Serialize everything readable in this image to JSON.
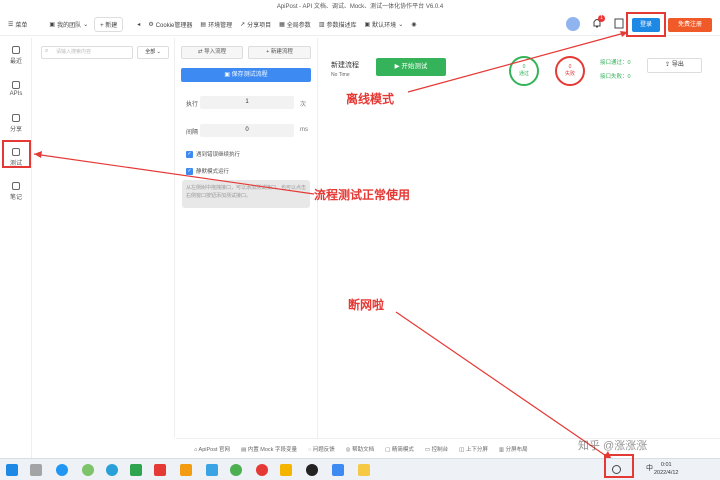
{
  "window": {
    "title": "ApiPost - API 文档、调试、Mock、测试一体化协作平台 V6.0.4"
  },
  "topbar": {
    "menu": "菜单",
    "team": "我的团队",
    "new": "+ 新建",
    "cookie": "Cookie管理器",
    "env": "环境管理",
    "share": "分享项目",
    "global": "全局参数",
    "params": "参数描述库",
    "env_select": "默认环境",
    "login": "登录",
    "register": "免费注册",
    "badge": "1"
  },
  "nav": [
    {
      "label": "最近"
    },
    {
      "label": "APIs"
    },
    {
      "label": "分享"
    },
    {
      "label": "测试"
    },
    {
      "label": "笔记"
    }
  ],
  "listpane": {
    "search_placeholder": "请输入搜索内容",
    "scope": "全部"
  },
  "flowpane": {
    "import": "导入流程",
    "new_flow": "新建流程",
    "save": "保存测试流程",
    "exec_label": "执行",
    "exec_value": "1",
    "exec_unit": "次",
    "interval_label": "间隔",
    "interval_value": "0",
    "interval_unit": "ms",
    "check_error": "遇到错误继续执行",
    "check_silent": "静默模式运行",
    "tip": "从左侧树中拖拽接口，可以添加测试接口。也可以点击右侧窗口按钮添加测试接口。"
  },
  "main": {
    "flow_title": "新建流程",
    "time": "No Time",
    "start": "开始测试",
    "pass_count": "0",
    "pass_label": "通过",
    "fail_count": "0",
    "fail_label": "失败",
    "pass_stat": "接口通过：0",
    "fail_stat": "接口失败：0",
    "export": "导出"
  },
  "statusbar": [
    "ApiPost 官网",
    "内置 Mock 字段变量",
    "问题反馈",
    "帮助文档",
    "精简模式",
    "控制台",
    "上下分屏",
    "分屏布局"
  ],
  "annotations": {
    "offline": "离线模式",
    "flow_ok": "流程测试正常使用",
    "net_down": "断网啦"
  },
  "taskbar": {
    "time": "0:01",
    "date": "2022/4/12",
    "ime": "中"
  },
  "watermark": "知乎 @涨涨涨",
  "colors": {
    "accent": "#3d8bf2",
    "start": "#35b35a",
    "register": "#f05a28",
    "annotation": "#e53935"
  }
}
